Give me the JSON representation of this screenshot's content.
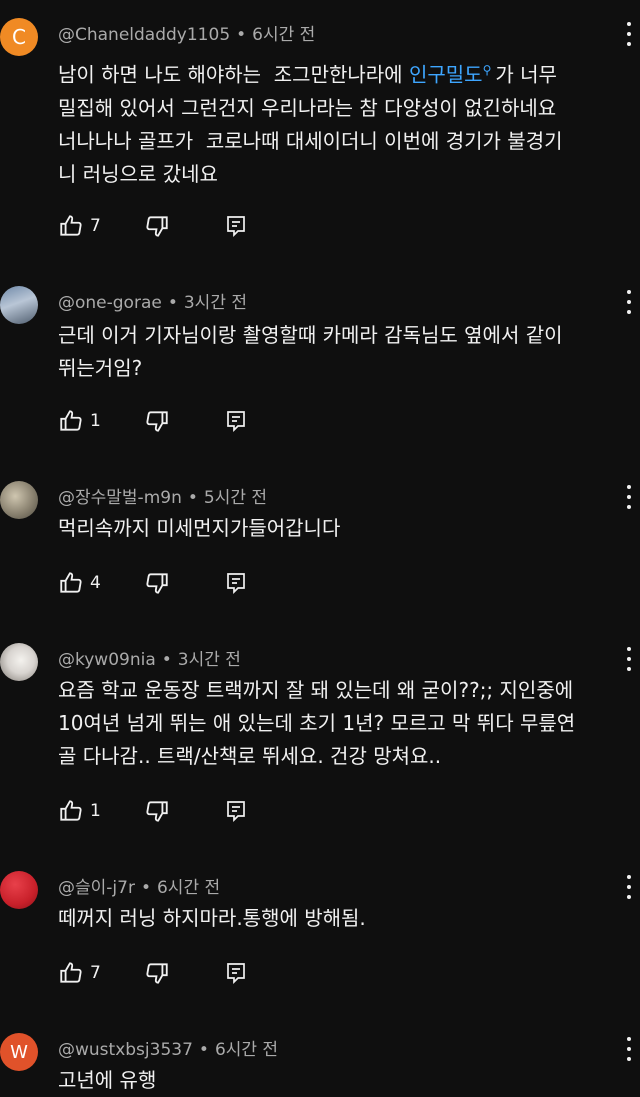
{
  "comments": [
    {
      "avatar_letter": "C",
      "avatar_color": "#f08a24",
      "author": "@Chaneldaddy1105",
      "time": "6시간 전",
      "text_part1": "남이 하면 나도 해야하는  조그만한나라에 ",
      "text_link": "인구밀도",
      "text_part2": "가 너무\n밀집해 있어서 그런건지 우리나라는 참 다양성이 없긴하네요\n너나나나 골프가  코로나때 대세이더니 이번에 경기가 불경기\n니 러닝으로 갔네요",
      "likes": "7"
    },
    {
      "avatar_letter": "",
      "avatar_color": "#8fa0b8",
      "author": "@one-gorae",
      "time": "3시간 전",
      "text": "근데 이거 기자님이랑 촬영할때 카메라 감독님도 옆에서 같이\n뛰는거임?",
      "likes": "1"
    },
    {
      "avatar_letter": "",
      "avatar_color": "#8a8270",
      "author": "@장수말벌-m9n",
      "time": "5시간 전",
      "text": "먹리속까지 미세먼지가들어갑니다",
      "likes": "4"
    },
    {
      "avatar_letter": "",
      "avatar_color": "#d8d4d0",
      "author": "@kyw09nia",
      "time": "3시간 전",
      "text": "요즘 학교 운동장 트랙까지 잘 돼 있는데 왜 굳이??;; 지인중에\n10여년 넘게 뛰는 애 있는데 초기 1년? 모르고 막 뛰다 무릎연\n골 다나감.. 트랙/산책로 뛰세요. 건강 망쳐요..",
      "likes": "1"
    },
    {
      "avatar_letter": "",
      "avatar_color": "#c8202a",
      "author": "@슬이-j7r",
      "time": "6시간 전",
      "text": "떼꺼지 러닝 하지마라.통행에 방해됨.",
      "likes": "7"
    },
    {
      "avatar_letter": "W",
      "avatar_color": "#e0522a",
      "author": "@wustxbsj3537",
      "time": "6시간 전",
      "text": "고년에 유행"
    }
  ],
  "icons": {
    "like": "thumbs-up-icon",
    "dislike": "thumbs-down-icon",
    "reply": "reply-icon",
    "more": "more-vert-icon"
  }
}
